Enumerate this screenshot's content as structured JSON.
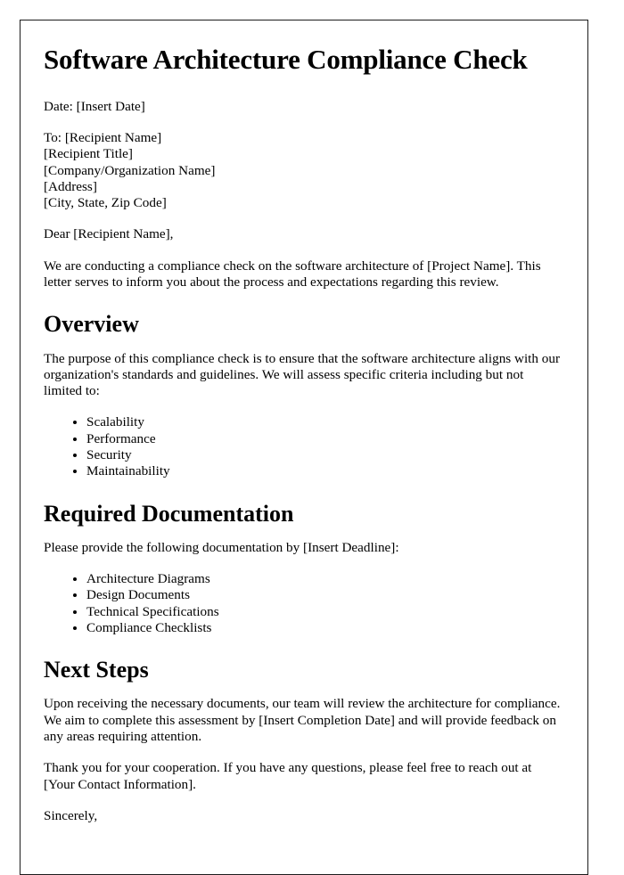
{
  "document": {
    "title": "Software Architecture Compliance Check",
    "date_line": "Date: [Insert Date]",
    "recipient_block": [
      "To: [Recipient Name]",
      "[Recipient Title]",
      "[Company/Organization Name]",
      "[Address]",
      "[City, State, Zip Code]"
    ],
    "salutation": "Dear [Recipient Name],",
    "intro_paragraph": "We are conducting a compliance check on the software architecture of [Project Name]. This letter serves to inform you about the process and expectations regarding this review.",
    "sections": [
      {
        "heading": "Overview",
        "paragraph": "The purpose of this compliance check is to ensure that the software architecture aligns with our organization's standards and guidelines. We will assess specific criteria including but not limited to:",
        "bullets": [
          "Scalability",
          "Performance",
          "Security",
          "Maintainability"
        ]
      },
      {
        "heading": "Required Documentation",
        "paragraph": "Please provide the following documentation by [Insert Deadline]:",
        "bullets": [
          "Architecture Diagrams",
          "Design Documents",
          "Technical Specifications",
          "Compliance Checklists"
        ]
      },
      {
        "heading": "Next Steps",
        "paragraph": "Upon receiving the necessary documents, our team will review the architecture for compliance. We aim to complete this assessment by [Insert Completion Date] and will provide feedback on any areas requiring attention.",
        "bullets": []
      }
    ],
    "thank_you_paragraph": "Thank you for your cooperation. If you have any questions, please feel free to reach out at [Your Contact Information].",
    "closing": "Sincerely,"
  }
}
